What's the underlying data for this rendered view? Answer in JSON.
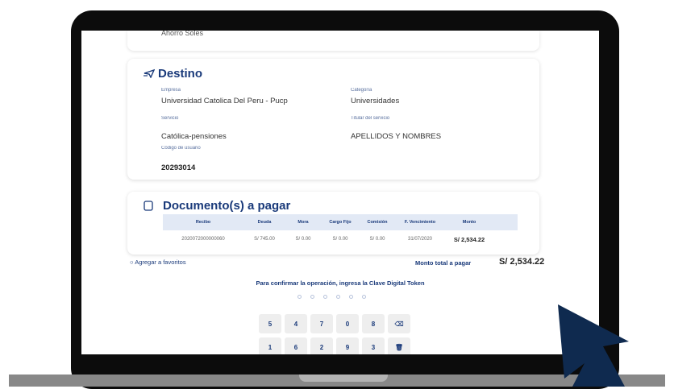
{
  "origin": {
    "account_text": "Ahorro Soles"
  },
  "destino": {
    "title": "Destino",
    "empresa_label": "Empresa",
    "empresa_value": "Universidad Catolica Del Peru - Pucp",
    "categoria_label": "Categoría",
    "categoria_value": "Universidades",
    "servicio_label": "Servicio",
    "servicio_value": "Católica-pensiones",
    "titular_label": "Titular del servicio",
    "titular_value": "APELLIDOS Y NOMBRES",
    "codigo_label": "Código de usuario",
    "codigo_value": "20293014"
  },
  "documentos": {
    "title": "Documento(s) a pagar",
    "columns": [
      "Recibo",
      "Deuda",
      "Mora",
      "Cargo Fijo",
      "Comisión",
      "F. Vencimiento",
      "Monto"
    ],
    "row": [
      "2020072000000060",
      "S/ 745.00",
      "S/ 0.00",
      "S/ 0.00",
      "S/ 0.00",
      "31/07/2020",
      "S/ 2,534.22"
    ]
  },
  "actions": {
    "favorites_label": "Agregar a favoritos",
    "total_label": "Monto total a pagar",
    "total_value": "S/ 2,534.22",
    "confirm_text": "Para confirmar la operación, ingresa la Clave Digital Token"
  },
  "keypad": {
    "keys": [
      "5",
      "4",
      "7",
      "0",
      "8",
      "⌫",
      "1",
      "6",
      "2",
      "9",
      "3",
      "🗑"
    ]
  },
  "colors": {
    "brand": "#1a3a7a",
    "cursor": "#0f2a4f",
    "laptop_body": "#0c0c0c",
    "laptop_base": "#888888"
  }
}
